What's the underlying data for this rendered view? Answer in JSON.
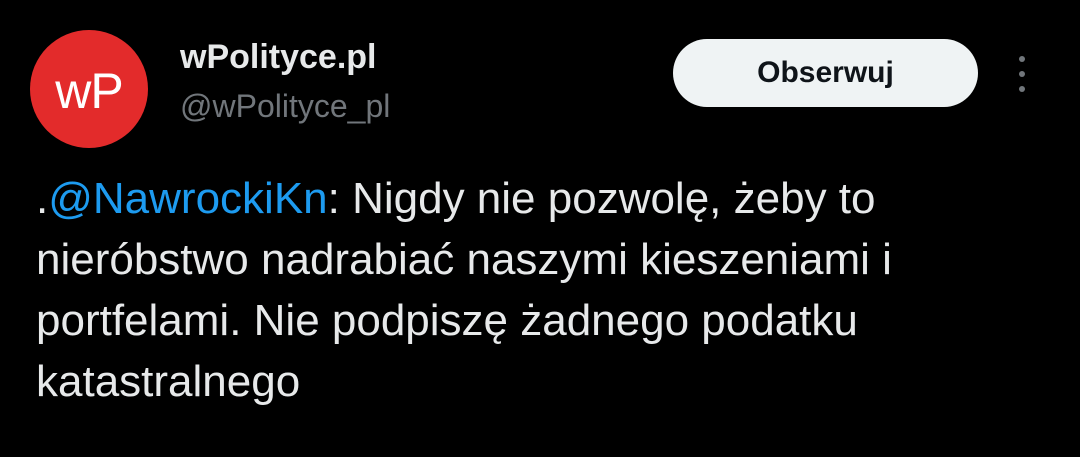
{
  "account": {
    "display_name": "wPolityce.pl",
    "handle": "@wPolityce_pl",
    "avatar_logo_w": "w",
    "avatar_logo_p": "P"
  },
  "actions": {
    "follow_label": "Obserwuj",
    "more_icon": "more-vertical-icon"
  },
  "tweet": {
    "prefix": ".",
    "mention": "@NawrockiKn",
    "text": ": Nigdy nie pozwolę, żeby to nieróbstwo nadrabiać naszymi kieszeniami i portfelami. Nie podpiszę żadnego podatku katastralnego"
  },
  "colors": {
    "background": "#000000",
    "avatar_red": "#e32b2b",
    "mention_blue": "#1d9bf0",
    "text_primary": "#e7e9ea",
    "text_secondary": "#71767b",
    "button_bg": "#eff3f4"
  }
}
